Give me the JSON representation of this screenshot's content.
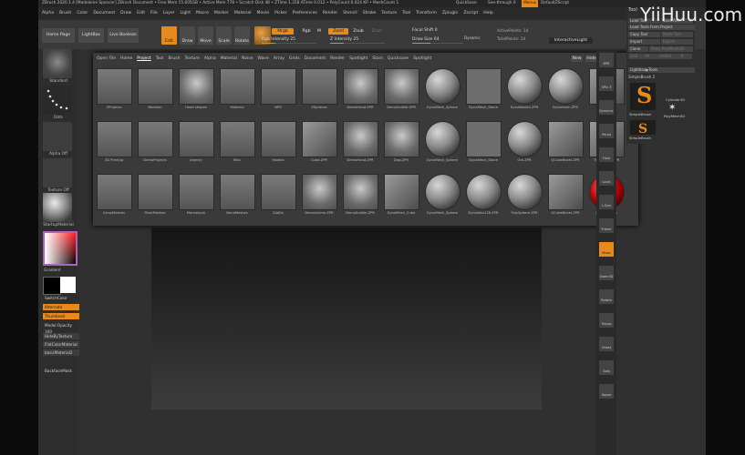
{
  "titlebar": {
    "text": "ZBrush 2020.1.4 [Madeleine Spencer] ZBrush Document   • Free Mem 15.605GB • Active Mem 778 • Scratch Disk 48 • ZTime 1.358 ATime 0.012 • PolyCount 0.024 KP • MeshCount 1",
    "quicksave": "QuickSave",
    "seethrough": "See-through 0",
    "menus": "Menus",
    "default": "DefaultZScript"
  },
  "menubar": [
    "Alpha",
    "Brush",
    "Color",
    "Document",
    "Draw",
    "Edit",
    "File",
    "Layer",
    "Light",
    "Macro",
    "Marker",
    "Material",
    "Movie",
    "Picker",
    "Preferences",
    "Render",
    "Stencil",
    "Stroke",
    "Texture",
    "Tool",
    "Transform",
    "Zplugin",
    "Zscript",
    "Help"
  ],
  "toolbar": {
    "home": "Home Page",
    "lightbox": "LightBox",
    "liveboolean": "Live Boolean",
    "edit": "Edit",
    "draw": "Draw",
    "move": "Move",
    "scale": "Scale",
    "rotate": "Rotate",
    "a": "A",
    "mrgb": "Mrgb",
    "rgb": "Rgb",
    "m": "M",
    "zadd": "Zadd",
    "zsub": "Zsub",
    "zcut": "Zcut",
    "rgb_intensity": "Rgb Intensity 25",
    "z_intensity": "Z Intensity 25",
    "focal_shift": "Focal Shift 0",
    "draw_size": "Draw Size 64",
    "dynamic": "Dynamic",
    "active_points": "ActivePoints: 14",
    "total_points": "TotalPoints: 14",
    "interactive_light": "InteractiveLight"
  },
  "lefttray": {
    "brush": "Standard",
    "stroke": "Dots",
    "alpha": "Alpha Off",
    "texture": "Texture Off",
    "material": "StartupMaterial",
    "gradient": "Gradient",
    "switchcolor": "SwitchColor",
    "alternate": "Alternate",
    "thumbnail": "Thumbnail",
    "model_opacity": "Model Opacity 100",
    "hide_by_texture": "HideByTexture",
    "flatcolor": "FlatColorMaterial",
    "basicmaterial": "basicMaterial2",
    "backface": "BackfaceMask"
  },
  "lightbox": {
    "tabs": [
      "Open File",
      "Home",
      "Project",
      "Tool",
      "Brush",
      "Texture",
      "Alpha",
      "Material",
      "Noise",
      "Wave",
      "Array",
      "Grids",
      "Document",
      "Render",
      "Spotlight",
      "Stars",
      "Quicksave",
      "Spotlight"
    ],
    "active_tab": "Project",
    "new": "New",
    "hide": "Hide",
    "rows": [
      [
        "ZProjects",
        "Boolean",
        "Head shapes",
        "Material",
        "NPR",
        "ZSpheres",
        "DemoHead.ZPR",
        "DemoSoldier.ZPR",
        "DynaMesh_Sphere",
        "DynaMesh_Stone",
        "DynaWax64.ZPR",
        "Dynamesh.ZPR",
        "QCube.ZPR"
      ],
      [
        "3D Printing",
        "DemoProjects",
        "Jewelry",
        "Misc",
        "Models",
        "Cube.ZPR",
        "DemoHead.ZPR",
        "Dog.ZPR",
        "DynaMesh_Sphere",
        "DynaMesh_Stone",
        "Orb.ZPR",
        "QCubeBevel.ZPR",
        "ThickPlane.ZPR"
      ],
      [
        "ArrayMeshes",
        "FiberMeshes",
        "Mannequin",
        "NanoMeshes",
        "ZAdDs",
        "DemoAnime.ZPR",
        "DemoSoldier.ZPR",
        "DynaMesh_Cube",
        "DynaMesh_Sphere",
        "DynaWax128.ZPR",
        "PolySphere.ZPR",
        "QCubeBevel.ZPR",
        "ZSphere.ZPR"
      ]
    ]
  },
  "righttray": [
    "BPR",
    "SPix 3",
    "Dynamic",
    "Persp",
    "Floor",
    "Local",
    "L.Sym",
    "Frame",
    "Move",
    "Zoom3D",
    "Rotate",
    "Transp",
    "Ghost",
    "Solo",
    "Xpose"
  ],
  "rightpanel": {
    "title": "Tool",
    "load": "Load Tool",
    "save": "Save As",
    "loadproject": "Load Tools From Project",
    "copy": "Copy Tool",
    "paste": "Paste Tool",
    "import": "Import",
    "export": "Export",
    "clone": "Clone",
    "make_polymesh": "Make PolyMesh3D",
    "goz": "GoZ",
    "all": "All",
    "visible": "Visible",
    "r": "R",
    "lightbox_tools": "Lightbox▶Tools",
    "simplebrush": "SimpleBrush  2",
    "tool_names": [
      "SimpleBrush",
      "Cylinder3D",
      "PolyMesh3D",
      "SimpleBrush"
    ]
  },
  "watermark": "YiiHuu.com"
}
